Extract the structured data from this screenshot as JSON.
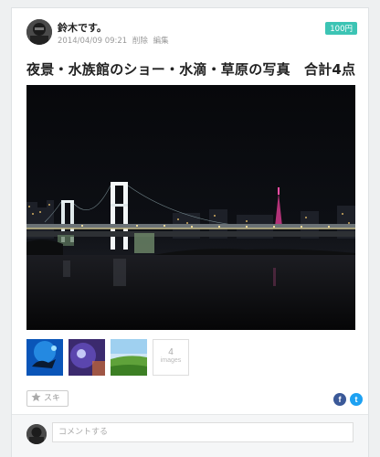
{
  "post": {
    "author": "鈴木です。",
    "date": "2014/04/09 09:21",
    "delete_label": "削除",
    "edit_label": "編集",
    "price": "100円",
    "title": "夜景・水族館のショー・水滴・草原の写真　合計4点"
  },
  "gallery": {
    "more_count": "4",
    "more_label": "images"
  },
  "actions": {
    "like_label": "スキ",
    "facebook_glyph": "f",
    "twitter_glyph": "t"
  },
  "comment": {
    "placeholder": "コメントする"
  },
  "colors": {
    "price_badge": "#3cc4b4",
    "facebook": "#3b5998",
    "twitter": "#1da1f2"
  }
}
